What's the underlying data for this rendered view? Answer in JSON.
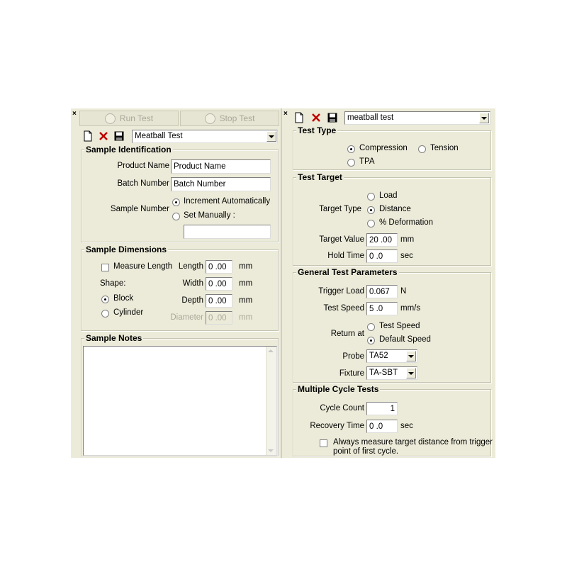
{
  "left": {
    "close_glyph": "×",
    "run_test_label": "Run Test",
    "stop_test_label": "Stop Test",
    "test_select_value": "Meatball Test",
    "sample_identification": {
      "title": "Sample Identification",
      "product_name_label": "Product Name",
      "product_name_value": "Product Name",
      "batch_number_label": "Batch Number",
      "batch_number_value": "Batch Number",
      "sample_number_label": "Sample Number",
      "increment_label": "Increment Automatically",
      "set_manually_label": "Set Manually :",
      "manual_value": ""
    },
    "sample_dimensions": {
      "title": "Sample Dimensions",
      "measure_length_label": "Measure Length",
      "shape_label": "Shape:",
      "block_label": "Block",
      "cylinder_label": "Cylinder",
      "length_label": "Length",
      "length_value": "0 .00",
      "width_label": "Width",
      "width_value": "0 .00",
      "depth_label": "Depth",
      "depth_value": "0 .00",
      "diameter_label": "Diameter",
      "diameter_value": "0 .00",
      "unit": "mm"
    },
    "sample_notes": {
      "title": "Sample Notes",
      "value": ""
    }
  },
  "right": {
    "close_glyph": "×",
    "test_select_value": "meatball test",
    "test_type": {
      "title": "Test Type",
      "compression_label": "Compression",
      "tension_label": "Tension",
      "tpa_label": "TPA"
    },
    "test_target": {
      "title": "Test Target",
      "target_type_label": "Target Type",
      "load_label": "Load",
      "distance_label": "Distance",
      "deformation_label": "% Deformation",
      "target_value_label": "Target Value",
      "target_value": "20 .00",
      "target_unit": "mm",
      "hold_time_label": "Hold Time",
      "hold_time_value": "0 .0",
      "hold_unit": "sec"
    },
    "general": {
      "title": "General Test Parameters",
      "trigger_load_label": "Trigger Load",
      "trigger_load_value": "0.067",
      "trigger_unit": "N",
      "test_speed_label": "Test Speed",
      "test_speed_value": "5 .0",
      "speed_unit": "mm/s",
      "return_at_label": "Return at",
      "test_speed_option": "Test Speed",
      "default_speed_option": "Default Speed",
      "probe_label": "Probe",
      "probe_value": "TA52",
      "fixture_label": "Fixture",
      "fixture_value": "TA-SBT"
    },
    "multiple": {
      "title": "Multiple Cycle Tests",
      "cycle_count_label": "Cycle Count",
      "cycle_count_value": "1",
      "recovery_time_label": "Recovery Time",
      "recovery_time_value": "0 .0",
      "recovery_unit": "sec",
      "always_measure_line1": "Always measure target distance from trigger",
      "always_measure_line2": "point of first cycle."
    }
  }
}
